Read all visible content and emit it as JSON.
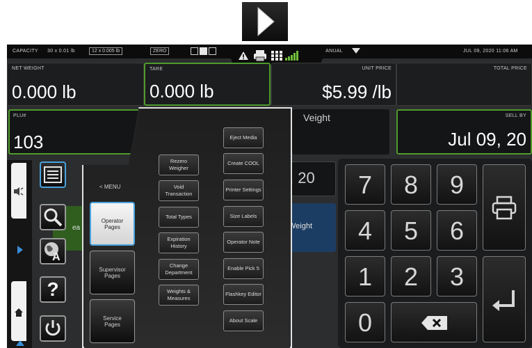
{
  "status": {
    "capacity_label": "CAPACITY",
    "capacity_range1": "30 x 0.01 lb",
    "capacity_range2": "12 x 0.005 lb",
    "zero_label": "ZERO",
    "mode": "MANUAL",
    "datetime": "JUL 09, 2020 11:06 AM"
  },
  "fields": {
    "net_weight_label": "NET WEIGHT",
    "net_weight_value": "0.000 lb",
    "tare_label": "TARE",
    "tare_value": "0.000 lb",
    "unit_price_label": "UNIT PRICE",
    "unit_price_value": "$5.99 /lb",
    "total_price_label": "TOTAL PRICE",
    "plu_label": "PLU#",
    "plu_value": "103",
    "weight_partial": "Veight",
    "sell_by_label": "SELL BY",
    "sell_by_value": "Jul 09, 20",
    "date_partial": ", 20",
    "weight_button_partial": "Weight",
    "left_partial": "ea"
  },
  "menu": {
    "title": "< MENU",
    "operator_pages": "Operator Pages",
    "supervisor_pages": "Supervisor Pages",
    "service_pages": "Service Pages",
    "col1": [
      "Rezero Weigher",
      "Void Transaction",
      "Total Types",
      "Expiration History",
      "Change Department",
      "Weights & Measures"
    ],
    "col2": [
      "Eject Media",
      "Create COOL",
      "Printer Settings",
      "Size Labels",
      "Operator Note",
      "Enable Pick 5",
      "Flashkey Editor",
      "About Scale"
    ]
  },
  "keypad": {
    "digits": [
      "7",
      "8",
      "9",
      "4",
      "5",
      "6",
      "1",
      "2",
      "3",
      "0"
    ]
  },
  "tools": {
    "help": "?"
  },
  "icons": [
    "play-arrow-icon",
    "warning-icon",
    "printer-icon",
    "grid-icon",
    "signal-icon",
    "dropdown-icon",
    "list-icon",
    "search-icon",
    "globe-icon",
    "help-icon",
    "power-icon",
    "home-icon",
    "backspace-icon",
    "enter-icon",
    "chevron-right-icon"
  ]
}
